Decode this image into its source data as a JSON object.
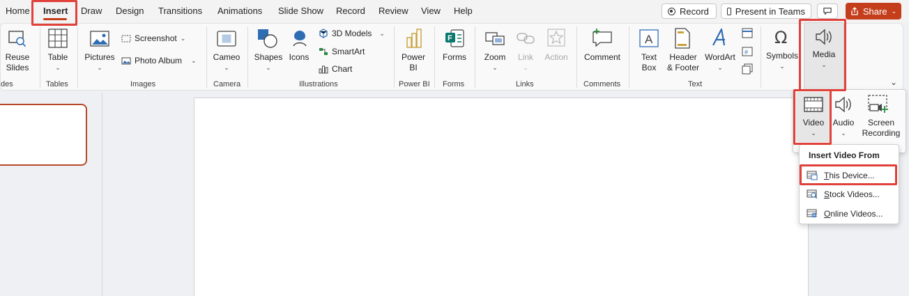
{
  "tabs": [
    "Home",
    "Insert",
    "Draw",
    "Design",
    "Transitions",
    "Animations",
    "Slide Show",
    "Record",
    "Review",
    "View",
    "Help"
  ],
  "topbar": {
    "record_label": "Record",
    "present_label": "Present in Teams",
    "share_label": "Share"
  },
  "ribbon": {
    "slides": {
      "reuse_line1": "Reuse",
      "reuse_line2": "Slides",
      "group": "des"
    },
    "tables": {
      "table": "Table",
      "group": "Tables"
    },
    "images": {
      "pictures": "Pictures",
      "screenshot": "Screenshot",
      "photo_album": "Photo Album",
      "group": "Images"
    },
    "camera": {
      "cameo": "Cameo",
      "group": "Camera"
    },
    "illustrations": {
      "shapes": "Shapes",
      "icons": "Icons",
      "models": "3D Models",
      "smartart": "SmartArt",
      "chart": "Chart",
      "group": "Illustrations"
    },
    "powerbi": {
      "line1": "Power",
      "line2": "BI",
      "group": "Power BI"
    },
    "forms": {
      "forms": "Forms",
      "group": "Forms"
    },
    "links": {
      "zoom": "Zoom",
      "link": "Link",
      "action": "Action",
      "group": "Links"
    },
    "comments": {
      "comment": "Comment",
      "group": "Comments"
    },
    "text": {
      "textbox_line1": "Text",
      "textbox_line2": "Box",
      "header_line1": "Header",
      "header_line2": "& Footer",
      "wordart": "WordArt",
      "group": "Text"
    },
    "symbols": {
      "symbols": "Symbols"
    },
    "media": {
      "media": "Media"
    }
  },
  "media_panel": {
    "video": "Video",
    "audio": "Audio",
    "screen_line1": "Screen",
    "screen_line2": "Recording"
  },
  "video_menu": {
    "header": "Insert Video From",
    "items": [
      {
        "underline": "T",
        "rest": "his Device..."
      },
      {
        "underline": "S",
        "rest": "tock Videos..."
      },
      {
        "underline": "O",
        "rest": "nline Videos..."
      }
    ]
  },
  "colors": {
    "accent": "#c43e1c",
    "highlight": "#e0413a"
  }
}
